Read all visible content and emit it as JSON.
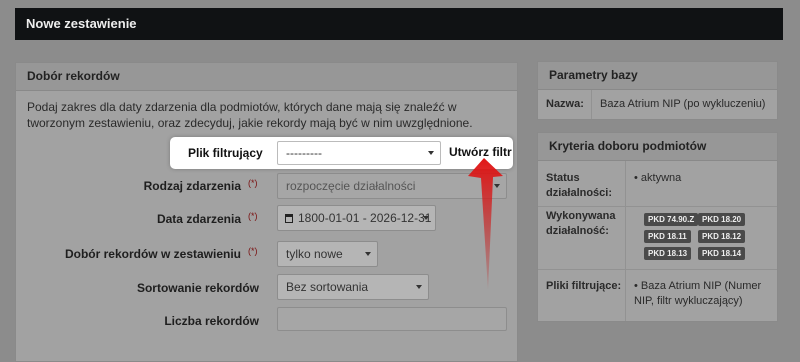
{
  "header": {
    "title": "Nowe zestawienie"
  },
  "left_panel": {
    "title": "Dobór rekordów",
    "intro": "Podaj zakres dla daty zdarzenia dla podmiotów, których dane mają się znaleźć w tworzonym zestawieniu, oraz zdecyduj, jakie rekordy mają być w nim uwzględnione.",
    "filter": {
      "label": "Plik filtrujący",
      "value": "---------",
      "create_button": "Utwórz filtr"
    },
    "event_type": {
      "label": "Rodzaj zdarzenia",
      "required": "(*)",
      "value": "rozpoczęcie działalności"
    },
    "event_date": {
      "label": "Data zdarzenia",
      "required": "(*)",
      "value": "1800-01-01 - 2026-12-31"
    },
    "record_choice": {
      "label": "Dobór rekordów w zestawieniu",
      "required": "(*)",
      "value": "tylko nowe"
    },
    "sorting": {
      "label": "Sortowanie rekordów",
      "value": "Bez sortowania"
    },
    "count": {
      "label": "Liczba rekordów",
      "value": ""
    }
  },
  "params_panel": {
    "title": "Parametry bazy",
    "name_label": "Nazwa:",
    "name_value": "Baza Atrium NIP (po wykluczeniu)"
  },
  "criteria_panel": {
    "title": "Kryteria doboru podmiotów",
    "status_label": "Status działalności:",
    "status_value": "aktywna",
    "activity_label": "Wykonywana działalność:",
    "activity_tags": [
      "PKD 74.90.Z",
      "PKD 18.20",
      "PKD 18.11",
      "PKD 18.12",
      "PKD 18.13",
      "PKD 18.14"
    ],
    "files_label": "Pliki filtrujące:",
    "files_value": "Baza Atrium NIP (Numer NIP, filtr wykluczający)"
  },
  "colors": {
    "arrow": "#e01515",
    "header_bg": "#101214"
  }
}
